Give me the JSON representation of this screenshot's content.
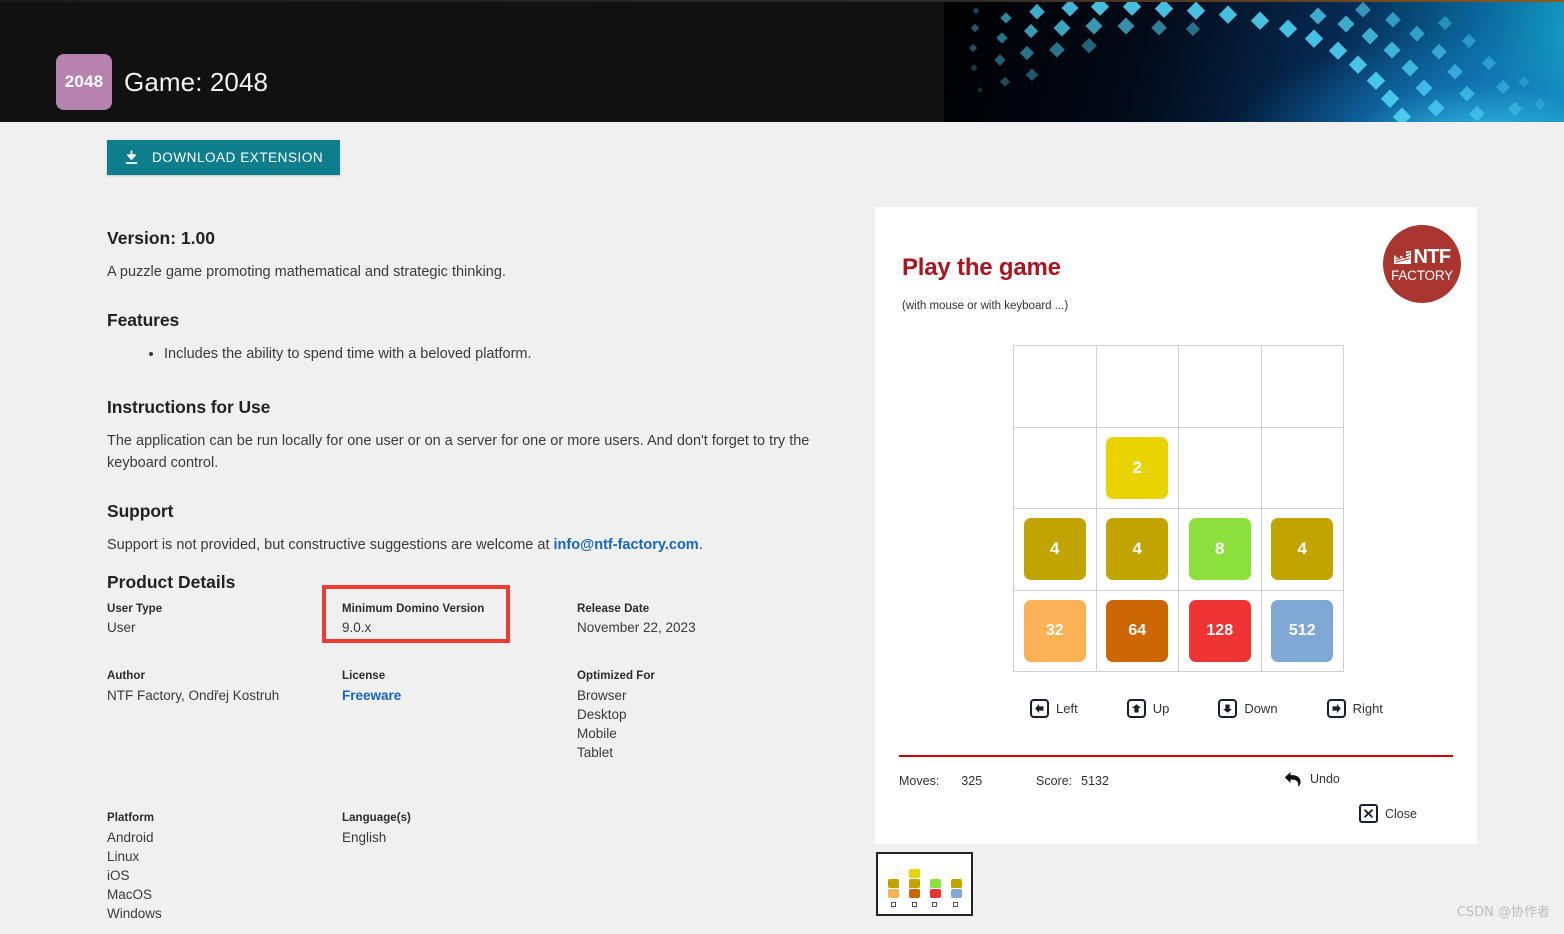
{
  "header": {
    "icon_label": "2048",
    "title": "Game: 2048",
    "banner_art_name": "blue-diamond-particles"
  },
  "toolbar": {
    "download_label": "DOWNLOAD EXTENSION"
  },
  "overview": {
    "version_heading": "Version: 1.00",
    "description": "A puzzle game promoting mathematical and strategic thinking.",
    "features_heading": "Features",
    "features": [
      "Includes the ability to spend time with a beloved platform."
    ],
    "instructions_heading": "Instructions for Use",
    "instructions_text": "The application can be run locally for one user or on a server for one or more users. And don't forget to try the keyboard control.",
    "support_heading": "Support",
    "support_text_before": "Support is not provided, but constructive suggestions are welcome at ",
    "support_email": "info@ntf-factory.com",
    "support_text_after": "."
  },
  "product_details": {
    "heading": "Product Details",
    "rows": [
      {
        "c1": {
          "label": "User Type",
          "value": "User"
        },
        "c2": {
          "label": "Minimum Domino Version",
          "value": "9.0.x",
          "highlighted": true
        },
        "c3": {
          "label": "Release Date",
          "value": "November 22, 2023"
        }
      },
      {
        "c1": {
          "label": "Author",
          "value": "NTF Factory, Ondřej Kostruh"
        },
        "c2": {
          "label": "License",
          "value": "Freeware",
          "is_link": true
        },
        "c3": {
          "label": "Optimized For",
          "values": [
            "Browser",
            "Desktop",
            "Mobile",
            "Tablet"
          ]
        }
      },
      {
        "c1": {
          "label": "Platform",
          "values": [
            "Android",
            "Linux",
            "iOS",
            "MacOS",
            "Windows"
          ]
        },
        "c2": {
          "label": "Language(s)",
          "value": "English"
        },
        "c3": {
          "label": "",
          "value": ""
        }
      }
    ],
    "highlight_color": "#ee3b33"
  },
  "game_panel": {
    "heading": "Play the game",
    "subheading": "(with mouse or with keyboard ...)",
    "logo": {
      "mark": "NTF",
      "sub": "FACTORY",
      "color": "#a8362f"
    },
    "board": {
      "rows": 4,
      "cols": 4,
      "tiles": [
        [
          null,
          null,
          null,
          null
        ],
        [
          null,
          "2",
          null,
          null
        ],
        [
          "4",
          "4",
          "8",
          "4"
        ],
        [
          "32",
          "64",
          "128",
          "512"
        ]
      ],
      "tile_colors": {
        "2": "#e8d200",
        "4": "#c2a400",
        "8": "#8ce03c",
        "32": "#fab254",
        "64": "#cc6600",
        "128": "#ee3333",
        "512": "#7fa8d4"
      }
    },
    "controls": [
      {
        "label": "Left",
        "icon": "arrow-left-key-icon"
      },
      {
        "label": "Up",
        "icon": "arrow-up-key-icon"
      },
      {
        "label": "Down",
        "icon": "arrow-down-key-icon"
      },
      {
        "label": "Right",
        "icon": "arrow-right-key-icon"
      }
    ],
    "status": {
      "moves_label": "Moves:",
      "moves_value": "325",
      "score_label": "Score:",
      "score_value": "5132",
      "undo_label": "Undo",
      "close_label": "Close",
      "rule_color": "#cc0000"
    }
  },
  "thumbnail": {
    "name": "game-screenshot-thumbnail"
  },
  "watermark": {
    "text": "CSDN @协作者"
  }
}
